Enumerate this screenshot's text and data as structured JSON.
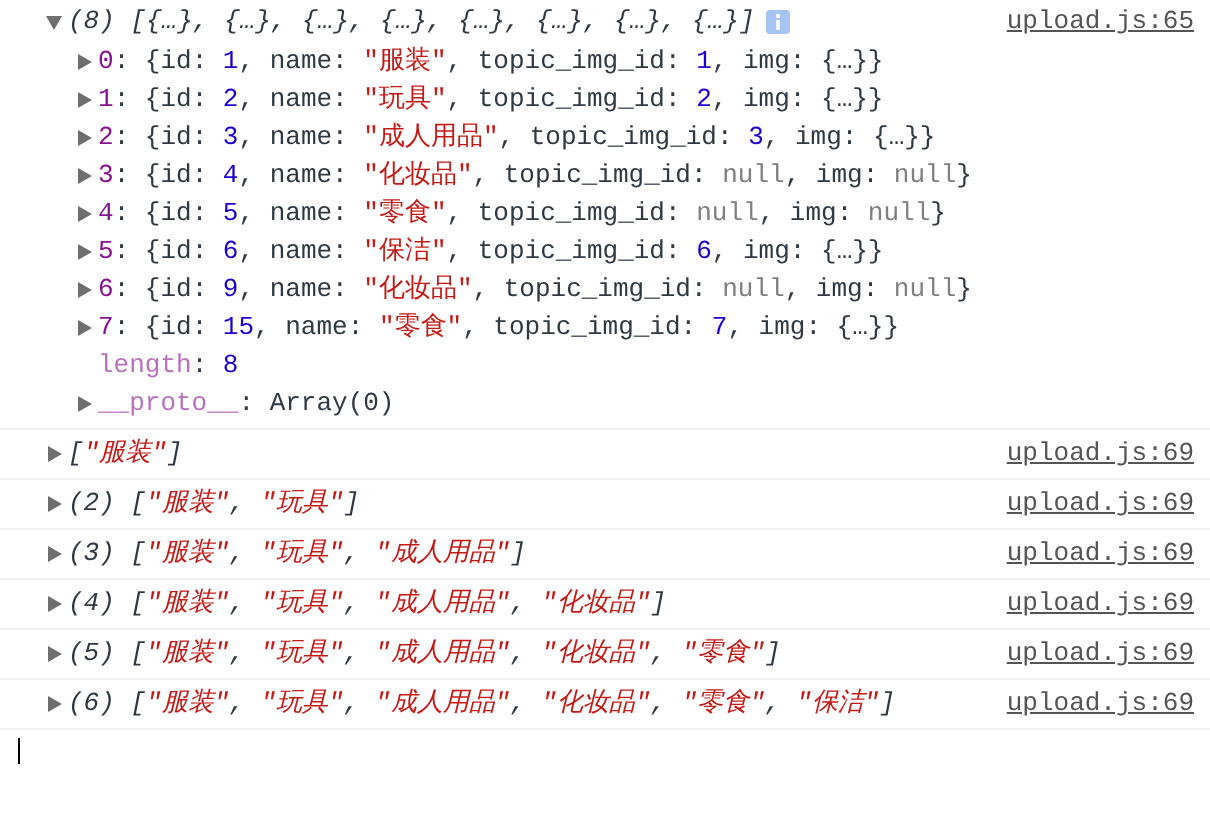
{
  "console": {
    "messages": [
      {
        "source": "upload.js:65",
        "expanded": true,
        "info_badge": true,
        "summary": [
          {
            "text": "(8) [{…}, {…}, {…}, {…}, {…}, {…}, {…}, {…}]",
            "kind": "plain"
          }
        ],
        "children": [
          {
            "expanded": false,
            "tokens": [
              {
                "text": "0",
                "kind": "key"
              },
              {
                "text": ": {id: ",
                "kind": "plain"
              },
              {
                "text": "1",
                "kind": "number"
              },
              {
                "text": ", name: ",
                "kind": "plain"
              },
              {
                "text": "\"服装\"",
                "kind": "string"
              },
              {
                "text": ", topic_img_id: ",
                "kind": "plain"
              },
              {
                "text": "1",
                "kind": "number"
              },
              {
                "text": ", img: {…}}",
                "kind": "plain"
              }
            ]
          },
          {
            "expanded": false,
            "tokens": [
              {
                "text": "1",
                "kind": "key"
              },
              {
                "text": ": {id: ",
                "kind": "plain"
              },
              {
                "text": "2",
                "kind": "number"
              },
              {
                "text": ", name: ",
                "kind": "plain"
              },
              {
                "text": "\"玩具\"",
                "kind": "string"
              },
              {
                "text": ", topic_img_id: ",
                "kind": "plain"
              },
              {
                "text": "2",
                "kind": "number"
              },
              {
                "text": ", img: {…}}",
                "kind": "plain"
              }
            ]
          },
          {
            "expanded": false,
            "tokens": [
              {
                "text": "2",
                "kind": "key"
              },
              {
                "text": ": {id: ",
                "kind": "plain"
              },
              {
                "text": "3",
                "kind": "number"
              },
              {
                "text": ", name: ",
                "kind": "plain"
              },
              {
                "text": "\"成人用品\"",
                "kind": "string"
              },
              {
                "text": ", topic_img_id: ",
                "kind": "plain"
              },
              {
                "text": "3",
                "kind": "number"
              },
              {
                "text": ", img: {…}}",
                "kind": "plain"
              }
            ]
          },
          {
            "expanded": false,
            "tokens": [
              {
                "text": "3",
                "kind": "key"
              },
              {
                "text": ": {id: ",
                "kind": "plain"
              },
              {
                "text": "4",
                "kind": "number"
              },
              {
                "text": ", name: ",
                "kind": "plain"
              },
              {
                "text": "\"化妆品\"",
                "kind": "string"
              },
              {
                "text": ", topic_img_id: ",
                "kind": "plain"
              },
              {
                "text": "null",
                "kind": "null"
              },
              {
                "text": ", img: ",
                "kind": "plain"
              },
              {
                "text": "null",
                "kind": "null"
              },
              {
                "text": "}",
                "kind": "plain"
              }
            ]
          },
          {
            "expanded": false,
            "tokens": [
              {
                "text": "4",
                "kind": "key"
              },
              {
                "text": ": {id: ",
                "kind": "plain"
              },
              {
                "text": "5",
                "kind": "number"
              },
              {
                "text": ", name: ",
                "kind": "plain"
              },
              {
                "text": "\"零食\"",
                "kind": "string"
              },
              {
                "text": ", topic_img_id: ",
                "kind": "plain"
              },
              {
                "text": "null",
                "kind": "null"
              },
              {
                "text": ", img: ",
                "kind": "plain"
              },
              {
                "text": "null",
                "kind": "null"
              },
              {
                "text": "}",
                "kind": "plain"
              }
            ]
          },
          {
            "expanded": false,
            "tokens": [
              {
                "text": "5",
                "kind": "key"
              },
              {
                "text": ": {id: ",
                "kind": "plain"
              },
              {
                "text": "6",
                "kind": "number"
              },
              {
                "text": ", name: ",
                "kind": "plain"
              },
              {
                "text": "\"保洁\"",
                "kind": "string"
              },
              {
                "text": ", topic_img_id: ",
                "kind": "plain"
              },
              {
                "text": "6",
                "kind": "number"
              },
              {
                "text": ", img: {…}}",
                "kind": "plain"
              }
            ]
          },
          {
            "expanded": false,
            "tokens": [
              {
                "text": "6",
                "kind": "key"
              },
              {
                "text": ": {id: ",
                "kind": "plain"
              },
              {
                "text": "9",
                "kind": "number"
              },
              {
                "text": ", name: ",
                "kind": "plain"
              },
              {
                "text": "\"化妆品\"",
                "kind": "string"
              },
              {
                "text": ", topic_img_id: ",
                "kind": "plain"
              },
              {
                "text": "null",
                "kind": "null"
              },
              {
                "text": ", img: ",
                "kind": "plain"
              },
              {
                "text": "null",
                "kind": "null"
              },
              {
                "text": "}",
                "kind": "plain"
              }
            ]
          },
          {
            "expanded": false,
            "tokens": [
              {
                "text": "7",
                "kind": "key"
              },
              {
                "text": ": {id: ",
                "kind": "plain"
              },
              {
                "text": "15",
                "kind": "number"
              },
              {
                "text": ", name: ",
                "kind": "plain"
              },
              {
                "text": "\"零食\"",
                "kind": "string"
              },
              {
                "text": ", topic_img_id: ",
                "kind": "plain"
              },
              {
                "text": "7",
                "kind": "number"
              },
              {
                "text": ", img: {…}}",
                "kind": "plain"
              }
            ]
          },
          {
            "tokens": [
              {
                "text": "length",
                "kind": "meta"
              },
              {
                "text": ": ",
                "kind": "plain"
              },
              {
                "text": "8",
                "kind": "number"
              }
            ]
          },
          {
            "expanded": false,
            "tokens": [
              {
                "text": "__proto__",
                "kind": "meta"
              },
              {
                "text": ": Array(0)",
                "kind": "plain"
              }
            ]
          }
        ]
      },
      {
        "source": "upload.js:69",
        "expanded": false,
        "summary": [
          {
            "text": "[",
            "kind": "plain"
          },
          {
            "text": "\"服装\"",
            "kind": "string"
          },
          {
            "text": "]",
            "kind": "plain"
          }
        ]
      },
      {
        "source": "upload.js:69",
        "expanded": false,
        "summary": [
          {
            "text": "(2) [",
            "kind": "plain"
          },
          {
            "text": "\"服装\"",
            "kind": "string"
          },
          {
            "text": ", ",
            "kind": "plain"
          },
          {
            "text": "\"玩具\"",
            "kind": "string"
          },
          {
            "text": "]",
            "kind": "plain"
          }
        ]
      },
      {
        "source": "upload.js:69",
        "expanded": false,
        "summary": [
          {
            "text": "(3) [",
            "kind": "plain"
          },
          {
            "text": "\"服装\"",
            "kind": "string"
          },
          {
            "text": ", ",
            "kind": "plain"
          },
          {
            "text": "\"玩具\"",
            "kind": "string"
          },
          {
            "text": ", ",
            "kind": "plain"
          },
          {
            "text": "\"成人用品\"",
            "kind": "string"
          },
          {
            "text": "]",
            "kind": "plain"
          }
        ]
      },
      {
        "source": "upload.js:69",
        "expanded": false,
        "summary": [
          {
            "text": "(4) [",
            "kind": "plain"
          },
          {
            "text": "\"服装\"",
            "kind": "string"
          },
          {
            "text": ", ",
            "kind": "plain"
          },
          {
            "text": "\"玩具\"",
            "kind": "string"
          },
          {
            "text": ", ",
            "kind": "plain"
          },
          {
            "text": "\"成人用品\"",
            "kind": "string"
          },
          {
            "text": ", ",
            "kind": "plain"
          },
          {
            "text": "\"化妆品\"",
            "kind": "string"
          },
          {
            "text": "]",
            "kind": "plain"
          }
        ]
      },
      {
        "source": "upload.js:69",
        "expanded": false,
        "summary": [
          {
            "text": "(5) [",
            "kind": "plain"
          },
          {
            "text": "\"服装\"",
            "kind": "string"
          },
          {
            "text": ", ",
            "kind": "plain"
          },
          {
            "text": "\"玩具\"",
            "kind": "string"
          },
          {
            "text": ", ",
            "kind": "plain"
          },
          {
            "text": "\"成人用品\"",
            "kind": "string"
          },
          {
            "text": ", ",
            "kind": "plain"
          },
          {
            "text": "\"化妆品\"",
            "kind": "string"
          },
          {
            "text": ", ",
            "kind": "plain"
          },
          {
            "text": "\"零食\"",
            "kind": "string"
          },
          {
            "text": "]",
            "kind": "plain"
          }
        ]
      },
      {
        "source": "upload.js:69",
        "expanded": false,
        "summary": [
          {
            "text": "(6) [",
            "kind": "plain"
          },
          {
            "text": "\"服装\"",
            "kind": "string"
          },
          {
            "text": ", ",
            "kind": "plain"
          },
          {
            "text": "\"玩具\"",
            "kind": "string"
          },
          {
            "text": ", ",
            "kind": "plain"
          },
          {
            "text": "\"成人用品\"",
            "kind": "string"
          },
          {
            "text": ", ",
            "kind": "plain"
          },
          {
            "text": "\"化妆品\"",
            "kind": "string"
          },
          {
            "text": ", ",
            "kind": "plain"
          },
          {
            "text": "\"零食\"",
            "kind": "string"
          },
          {
            "text": ", ",
            "kind": "plain"
          },
          {
            "text": "\"保洁\"",
            "kind": "string"
          },
          {
            "text": "]",
            "kind": "plain"
          }
        ]
      }
    ]
  }
}
